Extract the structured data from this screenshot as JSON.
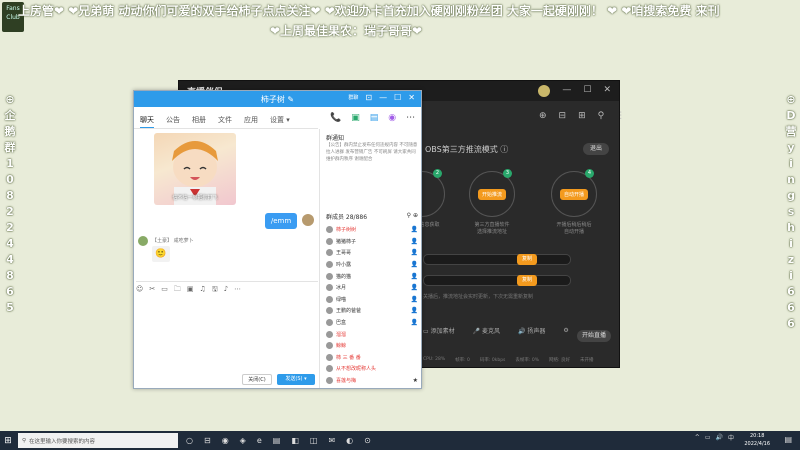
{
  "overlay": {
    "line1": "上房管❤ ❤兄弟萌 动动你们可爱的双手给柿子点点关注❤ ❤欢迎办卡首充加入硬刚刚粉丝团 大家一起硬刚刚！ ❤ ❤咱搜索免费 来刊",
    "line2": "❤上周最佳果农：瑞子哥哥❤",
    "logo": "Fans Club",
    "left_vertical": [
      "⊕",
      "企",
      "鹅",
      "群",
      "1",
      "0",
      "8",
      "2",
      "2",
      "4",
      "4",
      "8",
      "6",
      "5"
    ],
    "right_vertical": [
      "⊕",
      "D",
      "营",
      "y",
      "i",
      "n",
      "g",
      "s",
      "h",
      "i",
      "z",
      "i",
      "6",
      "6",
      "6"
    ]
  },
  "obs": {
    "brand": "直播伴侣",
    "mode_label": "OBS第三方推流模式 ⓘ",
    "exit_label": "退出",
    "toolbar_icons": [
      "⊕",
      "⊟",
      "⊞",
      "⚲",
      "⋮"
    ],
    "window_controls": [
      "—",
      "☐",
      "✕"
    ],
    "steps": [
      {
        "num": "2",
        "pill": "",
        "text": "直播间信息获取"
      },
      {
        "num": "3",
        "pill": "开始推流",
        "text": "第三方直播软件\n选择推流地址"
      },
      {
        "num": "4",
        "pill": "自动开播",
        "text": "开播后稍后稍后\n自动开播"
      }
    ],
    "copy_label": "复制",
    "hint": "关播后，推流地址会实时更新，下次无需重新复制",
    "bottom_tools": [
      "▭ 添加素材",
      "🎤 麦克风",
      "🔊 扬声器",
      "⚙"
    ],
    "live_label": "开始直播",
    "status_items": [
      "CPU: 28%",
      "帧率: 0",
      "码率: 0kbps",
      "丢帧率: 0%",
      "网络: 良好",
      "未开播"
    ]
  },
  "qq": {
    "title": "柿子树 ✎",
    "tag": "群聊",
    "window_controls": [
      "⊡",
      "—",
      "☐",
      "✕"
    ],
    "tabs": [
      "聊天",
      "公告",
      "相册",
      "文件",
      "应用",
      "设置 ▾"
    ],
    "top_icons": [
      "📞",
      "▣",
      "▤",
      "◉",
      "⋯"
    ],
    "sticker_caption": "信不信一拳把你打飞",
    "outgoing_msg": "/emm",
    "incoming_sender": "【土豪】 咸吃萝卜",
    "incoming_emoji": "🙂",
    "input_tools": [
      "☺",
      "✂",
      "▭",
      "🗀",
      "▣",
      "♫",
      "🖫",
      "♪",
      "⋯"
    ],
    "close_label": "关闭(C)",
    "send_label": "发送(S) ▾",
    "notice_title": "群通知",
    "notice_body": "【公告】群内禁止发布任何违规内容 不可随意拉人进群 发布营销广告 不可刷屏 请大家共同维护群内秩序 谢谢配合",
    "member_header": "群成员 28/886",
    "member_icons": "⚲ ⊕",
    "members": [
      {
        "name": "柿子树树",
        "color": "#e53935",
        "badge": "👤"
      },
      {
        "name": "猪猪柿子",
        "color": "#333",
        "badge": "👤"
      },
      {
        "name": "王哥哥",
        "color": "#333",
        "badge": "👤"
      },
      {
        "name": "吟小露",
        "color": "#333",
        "badge": "👤"
      },
      {
        "name": "猫的猫",
        "color": "#333",
        "badge": "👤"
      },
      {
        "name": "冰月",
        "color": "#333",
        "badge": "👤"
      },
      {
        "name": "绿喵",
        "color": "#333",
        "badge": "👤"
      },
      {
        "name": "王鹏的爸爸",
        "color": "#333",
        "badge": "👤"
      },
      {
        "name": "巴盒",
        "color": "#333",
        "badge": "👤"
      },
      {
        "name": "溜溜",
        "color": "#e53935",
        "badge": ""
      },
      {
        "name": "鲸鲸",
        "color": "#e53935",
        "badge": ""
      },
      {
        "name": "柿 三 番 番",
        "color": "#e53935",
        "badge": ""
      },
      {
        "name": "从不想改昵称人头",
        "color": "#e53935",
        "badge": ""
      },
      {
        "name": "喜莲与梅",
        "color": "#e53935",
        "badge": "★"
      }
    ]
  },
  "taskbar": {
    "start": "⊞",
    "search_icon": "⚲",
    "search_placeholder": "在这里输入你要搜索的内容",
    "apps": [
      "○",
      "⊟",
      "◉",
      "◈",
      "e",
      "▤",
      "◧",
      "◫",
      "✉",
      "◐",
      "⊙"
    ],
    "time": "20:18",
    "date": "2022/4/16",
    "tray": [
      "^",
      "▭",
      "🔊",
      "中"
    ],
    "notif": "▤"
  },
  "colors": {
    "qq_blue": "#2e9bea",
    "obs_orange": "#f39a1e",
    "obs_green": "#29a86c",
    "background": "#e8ecd9",
    "taskbar": "#1f2b3a"
  }
}
